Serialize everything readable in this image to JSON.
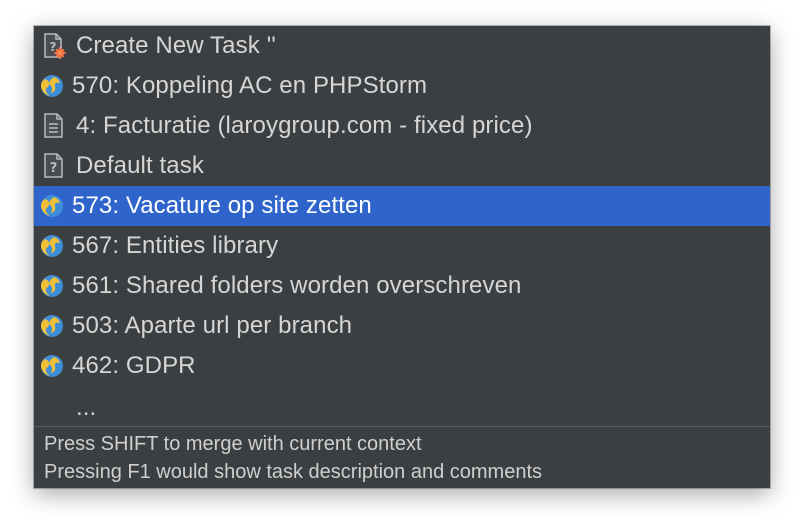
{
  "popup": {
    "items": [
      {
        "label": "Create New Task ''",
        "icon": "new-task-icon"
      },
      {
        "label": "570: Koppeling AC en PHPStorm",
        "icon": "globe-icon"
      },
      {
        "label": "4: Facturatie (laroygroup.com - fixed price)",
        "icon": "document-icon"
      },
      {
        "label": "Default task",
        "icon": "default-task-icon"
      },
      {
        "label": "573: Vacature op site zetten",
        "icon": "globe-icon",
        "selected": true
      },
      {
        "label": "567: Entities library",
        "icon": "globe-icon"
      },
      {
        "label": "561: Shared folders worden overschreven",
        "icon": "globe-icon"
      },
      {
        "label": "503: Aparte url per branch",
        "icon": "globe-icon"
      },
      {
        "label": "462: GDPR",
        "icon": "globe-icon"
      }
    ],
    "more_label": "...",
    "hints": [
      "Press SHIFT to merge with current context",
      "Pressing F1 would show task description and comments"
    ]
  },
  "colors": {
    "background": "#3c3f41",
    "selection": "#2f65ca",
    "text": "#d6d6d6"
  }
}
